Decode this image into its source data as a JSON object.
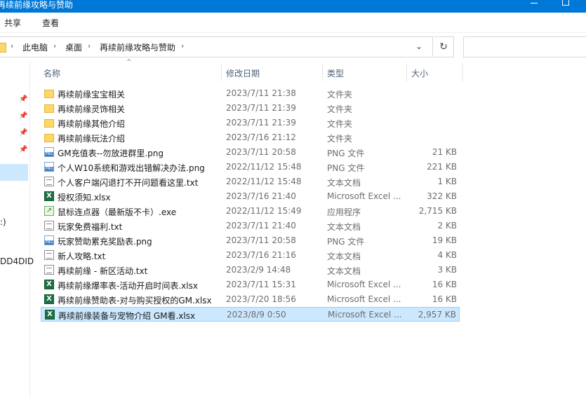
{
  "window": {
    "title": "再续前缘攻略与赞助"
  },
  "ribbon": {
    "tabs": [
      "共享",
      "查看"
    ]
  },
  "address": {
    "crumbs": [
      "此电脑",
      "桌面",
      "再续前缘攻略与赞助"
    ],
    "refresh_icon": "↻"
  },
  "nav": {
    "items": [
      ":)",
      "DD4DID"
    ]
  },
  "columns": {
    "name": "名称",
    "date": "修改日期",
    "type": "类型",
    "size": "大小"
  },
  "files": [
    {
      "name": "再续前缘宝宝相关",
      "date": "2023/7/11 21:38",
      "type": "文件夹",
      "size": "",
      "icon": "folder"
    },
    {
      "name": "再续前缘灵饰相关",
      "date": "2023/7/11 21:39",
      "type": "文件夹",
      "size": "",
      "icon": "folder"
    },
    {
      "name": "再续前缘其他介绍",
      "date": "2023/7/11 21:39",
      "type": "文件夹",
      "size": "",
      "icon": "folder"
    },
    {
      "name": "再续前缘玩法介绍",
      "date": "2023/7/16 21:12",
      "type": "文件夹",
      "size": "",
      "icon": "folder"
    },
    {
      "name": "GM充值表--勿放进群里.png",
      "date": "2023/7/11 20:58",
      "type": "PNG 文件",
      "size": "21 KB",
      "icon": "png"
    },
    {
      "name": "个人W10系统和游戏出错解决办法.png",
      "date": "2022/11/12 15:48",
      "type": "PNG 文件",
      "size": "221 KB",
      "icon": "png"
    },
    {
      "name": "个人客户端闪退打不开问题看这里.txt",
      "date": "2022/11/12 15:48",
      "type": "文本文档",
      "size": "1 KB",
      "icon": "txt"
    },
    {
      "name": "授权须知.xlsx",
      "date": "2023/7/16 21:40",
      "type": "Microsoft Excel ...",
      "size": "322 KB",
      "icon": "xlsx"
    },
    {
      "name": "鼠标连点器（最新版不卡）.exe",
      "date": "2022/11/12 15:49",
      "type": "应用程序",
      "size": "2,715 KB",
      "icon": "exe"
    },
    {
      "name": "玩家免费福利.txt",
      "date": "2023/7/11 21:40",
      "type": "文本文档",
      "size": "2 KB",
      "icon": "txt"
    },
    {
      "name": "玩家赞助累充奖励表.png",
      "date": "2023/7/11 20:58",
      "type": "PNG 文件",
      "size": "19 KB",
      "icon": "png"
    },
    {
      "name": "新人攻略.txt",
      "date": "2023/7/16 21:16",
      "type": "文本文档",
      "size": "4 KB",
      "icon": "txt"
    },
    {
      "name": "再续前缘 - 新区活动.txt",
      "date": "2023/2/9 14:48",
      "type": "文本文档",
      "size": "3 KB",
      "icon": "txt"
    },
    {
      "name": "再续前缘爆率表-活动开启时间表.xlsx",
      "date": "2023/7/11 15:31",
      "type": "Microsoft Excel ...",
      "size": "16 KB",
      "icon": "xlsx"
    },
    {
      "name": "再续前缘赞助表-对与购买授权的GM.xlsx",
      "date": "2023/7/20 18:56",
      "type": "Microsoft Excel ...",
      "size": "16 KB",
      "icon": "xlsx"
    },
    {
      "name": "再续前缘装备与宠物介绍 GM看.xlsx",
      "date": "2023/8/9 0:50",
      "type": "Microsoft Excel ...",
      "size": "2,957 KB",
      "icon": "xlsx",
      "selected": true
    }
  ]
}
